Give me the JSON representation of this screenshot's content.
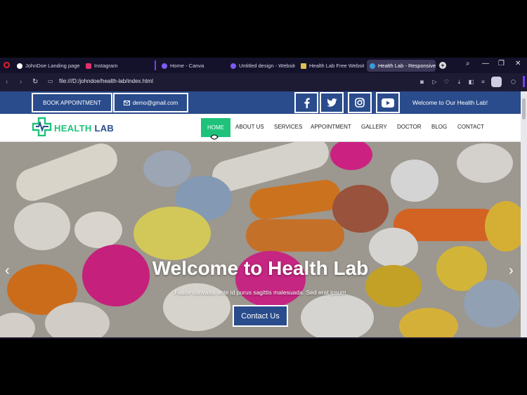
{
  "browser": {
    "tabs": [
      {
        "label": "JohnDoe Landing page |",
        "icon_color": "#ffffff"
      },
      {
        "label": "Instagram",
        "icon_color": "#e1306c"
      },
      {
        "label": "Home - Canva",
        "icon_color": "#7d5cf5"
      },
      {
        "label": "Untitled design - Website",
        "icon_color": "#7d5cf5"
      },
      {
        "label": "Health Lab Free Website",
        "icon_color": "#e0c050"
      },
      {
        "label": "Health Lab - Responsive",
        "icon_color": "#3a9ad9"
      }
    ],
    "new_tab": "+",
    "url": "file:///D:/johndoe/health-lab/index.html",
    "window_controls": {
      "minimize": "—",
      "restore": "❐",
      "close": "✕"
    }
  },
  "site": {
    "topbar": {
      "book_label": "BOOK APPOINTMENT",
      "email": "demo@gmail.com",
      "email_icon": "mail-icon",
      "social_icons": [
        "facebook-icon",
        "twitter-icon",
        "instagram-icon",
        "youtube-icon"
      ],
      "welcome": "Welcome to Our Health Lab!"
    },
    "logo": {
      "part1": "HEALTH",
      "part2": "LAB"
    },
    "menu": [
      "HOME",
      "ABOUT US",
      "SERVICES",
      "APPOINTMENT",
      "GALLERY",
      "DOCTOR",
      "BLOG",
      "CONTACT"
    ],
    "active_menu": "HOME",
    "hero": {
      "title": "Welcome to Health Lab",
      "subtitle": "Fusce convallis ante id purus sagittis malesuada. Sed erat ipsum",
      "button": "Contact Us",
      "prev": "‹",
      "next": "›"
    }
  },
  "colors": {
    "brand_blue": "#2a4c8c",
    "brand_green": "#1ec27a",
    "browser_bg": "#1b1830",
    "accent_purple": "#7b3df0"
  }
}
